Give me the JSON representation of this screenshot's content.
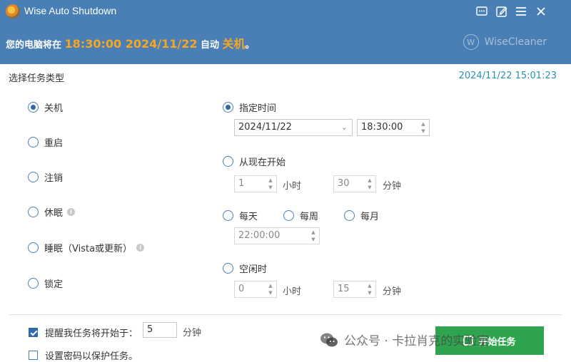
{
  "window": {
    "title": "Wise Auto Shutdown",
    "icons": [
      "chat-icon",
      "edit-icon",
      "menu-icon",
      "close-icon"
    ]
  },
  "status": {
    "prefix": "您的电脑将在",
    "time": "18:30:00 2024/11/22",
    "middle": "自动",
    "action": "关机",
    "suffix": "。"
  },
  "brand": {
    "name": "WiseCleaner",
    "logo_letter": "W"
  },
  "task_type": {
    "title": "选择任务类型",
    "current_datetime": "2024/11/22 15:01:23",
    "options": [
      {
        "label": "关机",
        "selected": true
      },
      {
        "label": "重启",
        "selected": false
      },
      {
        "label": "注销",
        "selected": false
      },
      {
        "label": "休眠",
        "selected": false,
        "info": true
      },
      {
        "label": "睡眠（Vista或更新）",
        "selected": false,
        "info": true
      },
      {
        "label": "锁定",
        "selected": false
      }
    ]
  },
  "schedule": {
    "specific": {
      "label": "指定时间",
      "selected": true,
      "date": "2024/11/22",
      "time": "18:30:00"
    },
    "from_now": {
      "label": "从现在开始",
      "selected": false,
      "hours": "1",
      "hours_unit": "小时",
      "minutes": "30",
      "minutes_unit": "分钟"
    },
    "daily": {
      "label": "每天",
      "selected": false
    },
    "weekly": {
      "label": "每周",
      "selected": false
    },
    "monthly": {
      "label": "每月",
      "selected": false
    },
    "recurring_time": "22:00:00",
    "idle": {
      "label": "空闲时",
      "selected": false,
      "hours": "0",
      "hours_unit": "小时",
      "minutes": "15",
      "minutes_unit": "分钟"
    }
  },
  "footer": {
    "remind": {
      "label": "提醒我任务将开始于：",
      "checked": true,
      "value": "5",
      "unit": "分钟"
    },
    "password": {
      "label": "设置密码以保护任务。",
      "checked": false
    },
    "start_button": "开始任务"
  },
  "watermark": "公众号 · 卡拉肖克的实验室",
  "colors": {
    "header": "#4a7fb5",
    "highlight": "#f5a623",
    "clock": "#2a8fb5",
    "button": "#2fa44f"
  }
}
